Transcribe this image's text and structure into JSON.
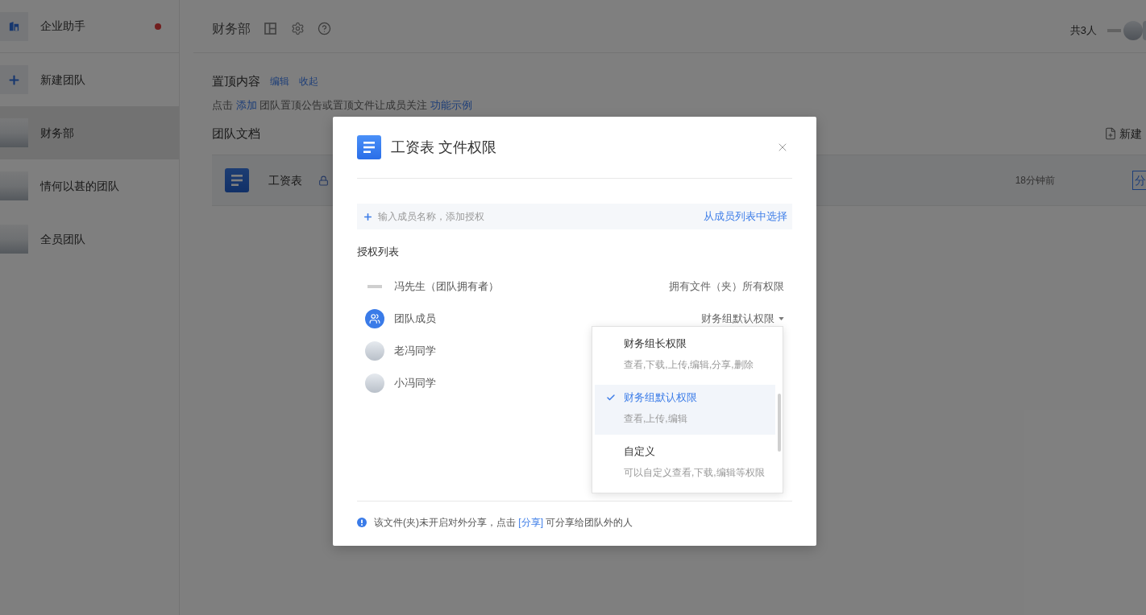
{
  "sidebar": {
    "items": [
      {
        "kind": "assistant",
        "label": "企业助手",
        "selected": false,
        "unread": true
      },
      {
        "kind": "new",
        "label": "新建团队",
        "selected": false,
        "unread": false
      },
      {
        "kind": "team",
        "label": "财务部",
        "selected": true,
        "unread": false
      },
      {
        "kind": "team",
        "label": "情何以甚的团队",
        "selected": false,
        "unread": false
      },
      {
        "kind": "team",
        "label": "全员团队",
        "selected": false,
        "unread": false
      }
    ]
  },
  "header": {
    "title": "财务部",
    "member_count": "共3人"
  },
  "pinned": {
    "title": "置顶内容",
    "actions": [
      "编辑",
      "收起"
    ],
    "hint": [
      {
        "kind": "text",
        "text": "点击 "
      },
      {
        "kind": "link",
        "text": "添加"
      },
      {
        "kind": "text",
        "text": " 团队置顶公告或置顶文件让成员关注 "
      },
      {
        "kind": "link",
        "text": "功能示例"
      }
    ]
  },
  "documents": {
    "title": "团队文档",
    "new_button": "新建",
    "files": [
      {
        "name": "工资表",
        "locked": true,
        "time": "18分钟前",
        "action": "分"
      }
    ]
  },
  "dialog": {
    "title": "工资表 文件权限",
    "search": {
      "placeholder": "输入成员名称，添加授权"
    },
    "pick_link": "从成员列表中选择",
    "list_title": "授权列表",
    "members": [
      {
        "kind": "logo",
        "name": "冯先生（团队拥有者）",
        "permission": "拥有文件（夹）所有权限"
      },
      {
        "kind": "group",
        "name": "团队成员",
        "permission": "财务组默认权限",
        "expanded": true,
        "options": [
          {
            "title": "财务组长权限",
            "description": "查看,下载,上传,编辑,分享,删除",
            "selected": false
          },
          {
            "title": "财务组默认权限",
            "description": "查看,上传,编辑",
            "selected": true
          },
          {
            "title": "自定义",
            "description": "可以自定义查看,下载,编辑等权限",
            "selected": false
          }
        ]
      },
      {
        "kind": "photo",
        "name": "老冯同学"
      },
      {
        "kind": "photo",
        "name": "小冯同学"
      }
    ],
    "notice": [
      {
        "kind": "text",
        "text": "该文件(夹)未开启对外分享，点击 "
      },
      {
        "kind": "link",
        "text": "[分享]"
      },
      {
        "kind": "text",
        "text": " 可分享给团队外的人"
      }
    ]
  }
}
